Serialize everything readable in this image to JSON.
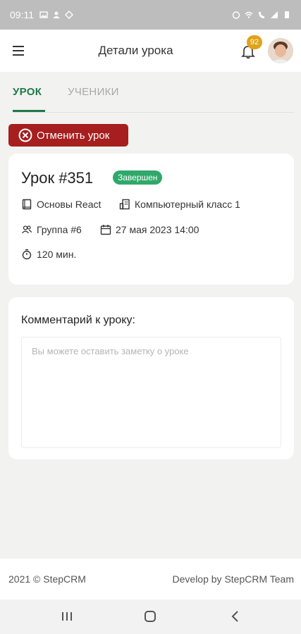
{
  "status_bar": {
    "time": "09:11"
  },
  "header": {
    "title": "Детали урока",
    "notifications_count": "92"
  },
  "tabs": [
    {
      "label": "УРОК",
      "active": true
    },
    {
      "label": "УЧЕНИКИ",
      "active": false
    }
  ],
  "cancel_button": {
    "label": "Отменить урок"
  },
  "lesson": {
    "title": "Урок #351",
    "status": "Завершен",
    "course": "Основы React",
    "room": "Компьютерный класс 1",
    "group": "Группа #6",
    "datetime": "27 мая 2023 14:00",
    "duration": "120 мин."
  },
  "comment": {
    "label": "Комментарий к уроку:",
    "placeholder": "Вы можете оставить заметку о уроке",
    "value": ""
  },
  "footer": {
    "left": "2021 © StepCRM",
    "right": "Develop by StepCRM Team"
  },
  "colors": {
    "accent_green": "#1f7a4a",
    "status_green": "#2fa86a",
    "cancel_red": "#a61e1e",
    "badge_orange": "#e0a21a"
  }
}
